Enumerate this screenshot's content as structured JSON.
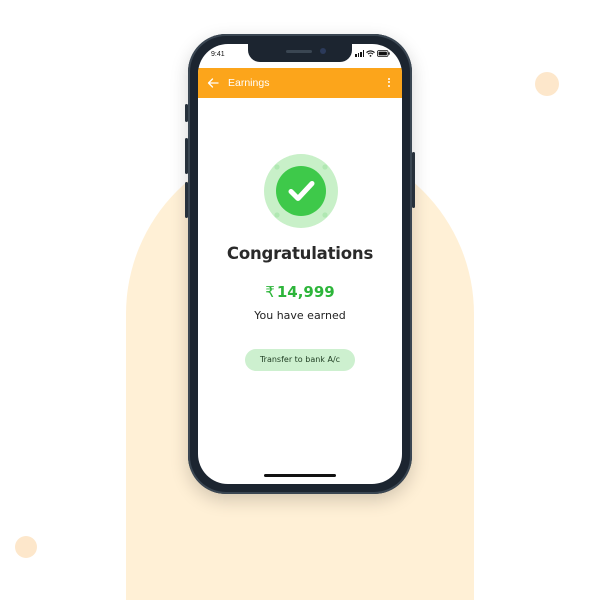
{
  "status_bar": {
    "time": "9:41",
    "signal_icon": "signal-icon",
    "wifi_icon": "wifi-icon",
    "battery_icon": "battery-icon"
  },
  "app_bar": {
    "title": "Earnings",
    "back_icon": "arrow-left-icon",
    "menu_icon": "more-vertical-icon",
    "color": "#fca51b"
  },
  "success": {
    "icon": "check-circle-icon",
    "headline": "Congratulations",
    "currency_symbol": "₹",
    "amount": "14,999",
    "subtitle": "You have earned",
    "accent_color": "#2db53a"
  },
  "actions": {
    "transfer_label": "Transfer to bank A/c",
    "transfer_bg": "#cdf0cf"
  },
  "theme": {
    "background_shape": "#fff0d6",
    "phone_frame": "#1c2530"
  }
}
